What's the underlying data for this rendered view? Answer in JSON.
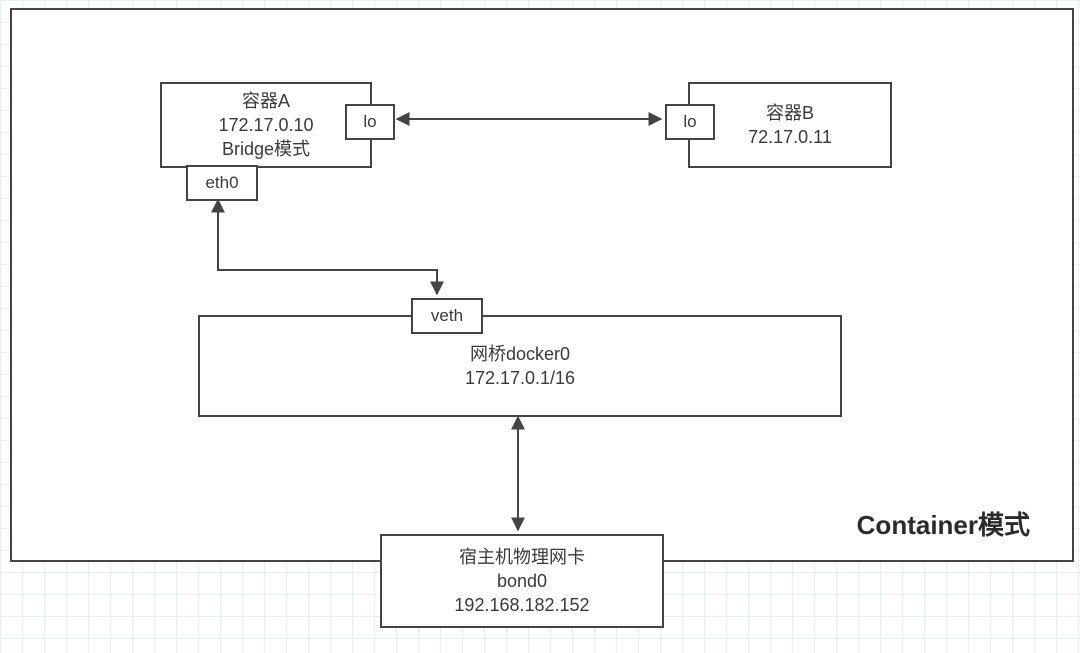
{
  "diagram": {
    "title": "Container模式",
    "containerA": {
      "name": "容器A",
      "ip": "172.17.0.10",
      "mode": "Bridge模式",
      "lo": "lo",
      "eth": "eth0"
    },
    "containerB": {
      "name": "容器B",
      "ip": "72.17.0.11",
      "lo": "lo"
    },
    "bridge": {
      "veth": "veth",
      "name": "网桥docker0",
      "cidr": "172.17.0.1/16"
    },
    "host": {
      "name": "宿主机物理网卡",
      "iface": "bond0",
      "ip": "192.168.182.152"
    }
  }
}
